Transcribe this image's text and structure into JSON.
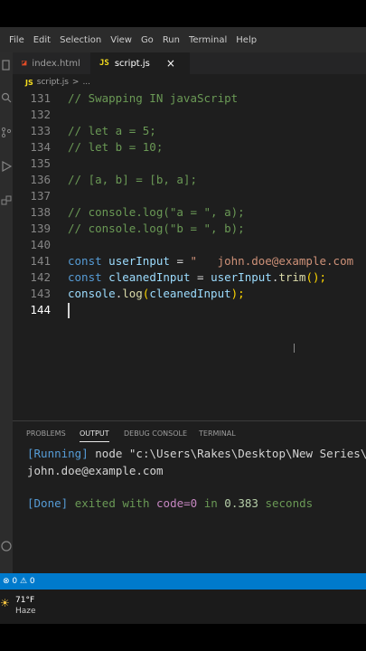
{
  "menu": [
    "File",
    "Edit",
    "Selection",
    "View",
    "Go",
    "Run",
    "Terminal",
    "Help"
  ],
  "tabs": [
    {
      "label": "index.html",
      "icon": "html-file-icon",
      "icon_glyph": "◪",
      "icon_color": "#e34c26"
    },
    {
      "label": "script.js",
      "icon": "js-file-icon",
      "icon_glyph": "JS",
      "icon_color": "#f7df1e",
      "close": "×"
    }
  ],
  "breadcrumb": {
    "file": "script.js",
    "sep": ">",
    "rest": "..."
  },
  "editor": {
    "line_numbers": [
      "131",
      "132",
      "133",
      "134",
      "135",
      "136",
      "137",
      "138",
      "139",
      "140",
      "141",
      "142",
      "143",
      "144"
    ],
    "lines": [
      {
        "t1": "// Swapping IN javaScript"
      },
      {},
      {
        "t1": "// let a = 5;"
      },
      {
        "t1": "// let b = 10;"
      },
      {},
      {
        "t1": "// [a, b] = [b, a];"
      },
      {},
      {
        "t1": "// console.log(\"a = \", a);"
      },
      {
        "t1": "// console.log(\"b = \", b);"
      },
      {},
      {
        "t1": "const",
        "t2": "userInput",
        "t3": "=",
        "t4": "\"   john.doe@example.com"
      },
      {
        "t1": "const",
        "t2": "cleanedInput",
        "t3": "=",
        "t4": "userInput",
        "t5": ".",
        "t6": "trim",
        "t7": "();"
      },
      {
        "t1": "console",
        "t2": ".",
        "t3": "log",
        "t4": "(",
        "t5": "cleanedInput",
        "t6": ");"
      },
      {}
    ]
  },
  "panel": {
    "tabs": [
      "PROBLEMS",
      "OUTPUT",
      "DEBUG CONSOLE",
      "TERMINAL"
    ],
    "output": {
      "running_label": "[Running]",
      "running_cmd": "node \"c:\\Users\\Rakes\\Desktop\\New Series\\",
      "result": "john.doe@example.com",
      "done_label": "[Done]",
      "done_text1": "exited with",
      "done_code": "code=0",
      "done_in": "in",
      "done_time": "0.383",
      "done_unit": "seconds"
    }
  },
  "status": {
    "problems": "⊗ 0 ⚠ 0"
  },
  "taskbar": {
    "temp": "71°F",
    "condition": "Haze"
  },
  "colors": {
    "accent": "#007acc",
    "comment": "#6a9955",
    "keyword": "#569cd6",
    "string": "#ce9178"
  }
}
